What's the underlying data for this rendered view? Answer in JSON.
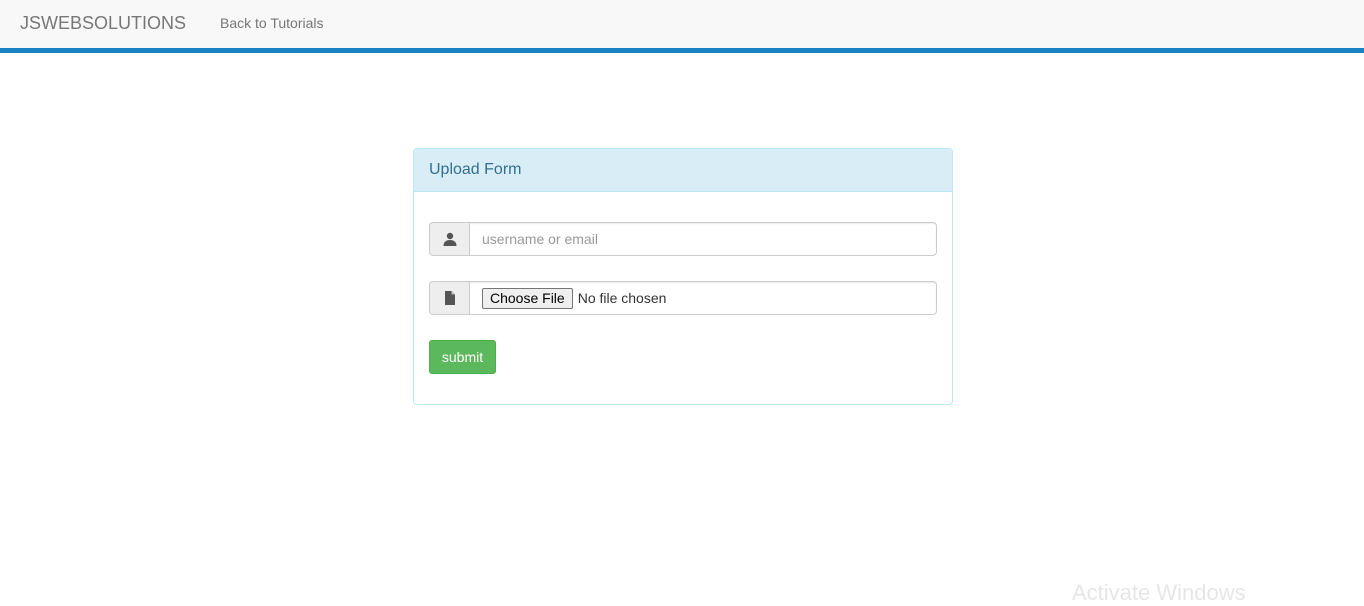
{
  "navbar": {
    "brand": "JSWEBSOLUTIONS",
    "link": "Back to Tutorials",
    "accent_color": "#1a80c4"
  },
  "panel": {
    "title": "Upload Form",
    "username": {
      "icon": "user-icon",
      "placeholder": "username or email",
      "value": ""
    },
    "file": {
      "icon": "file-icon",
      "button_label": "Choose File",
      "status": "No file chosen"
    },
    "submit_label": "submit",
    "submit_color": "#5cb85c"
  },
  "watermark": "Activate Windows"
}
